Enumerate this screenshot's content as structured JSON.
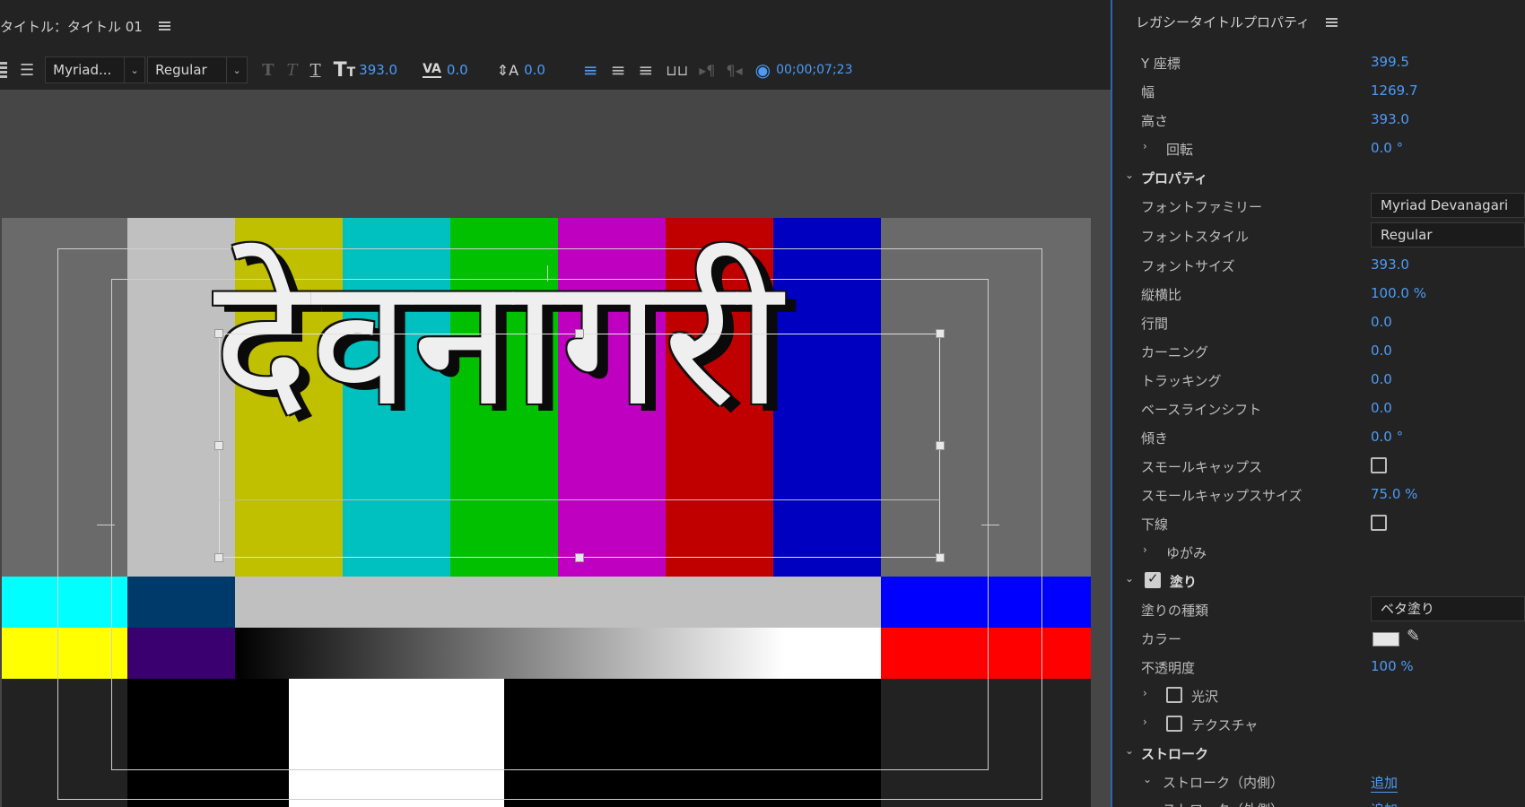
{
  "left_panel": {
    "title": "タイトル：タイトル 01",
    "toolbar": {
      "font_family": "Myriad...",
      "font_style": "Regular",
      "font_size": "393.0",
      "kerning": "0.0",
      "baseline": "0.0",
      "timecode": "00;00;07;23"
    },
    "canvas_text": "देवनागरी"
  },
  "right_panel": {
    "title": "レガシータイトルプロパティ",
    "rows": [
      {
        "label": "Y 座標",
        "value": "399.5"
      },
      {
        "label": "幅",
        "value": "1269.7"
      },
      {
        "label": "高さ",
        "value": "393.0"
      },
      {
        "label": "回転",
        "value": "0.0 °"
      },
      {
        "label": "プロパティ"
      },
      {
        "label": "フォントファミリー",
        "value": "Myriad Devanagari"
      },
      {
        "label": "フォントスタイル",
        "value": "Regular"
      },
      {
        "label": "フォントサイズ",
        "value": "393.0"
      },
      {
        "label": "縦横比",
        "value": "100.0 %"
      },
      {
        "label": "行間",
        "value": "0.0"
      },
      {
        "label": "カーニング",
        "value": "0.0"
      },
      {
        "label": "トラッキング",
        "value": "0.0"
      },
      {
        "label": "ベースラインシフト",
        "value": "0.0"
      },
      {
        "label": "傾き",
        "value": "0.0 °"
      },
      {
        "label": "スモールキャップス"
      },
      {
        "label": "スモールキャップスサイズ",
        "value": "75.0 %"
      },
      {
        "label": "下線"
      },
      {
        "label": "ゆがみ"
      },
      {
        "label": "塗り"
      },
      {
        "label": "塗りの種類",
        "value": "ベタ塗り"
      },
      {
        "label": "カラー"
      },
      {
        "label": "不透明度",
        "value": "100 %"
      },
      {
        "label": "光沢"
      },
      {
        "label": "テクスチャ"
      },
      {
        "label": "ストローク"
      },
      {
        "label": "ストローク（内側）",
        "value": "追加"
      },
      {
        "label": "ストローク（外側）",
        "value": "追加"
      }
    ]
  }
}
